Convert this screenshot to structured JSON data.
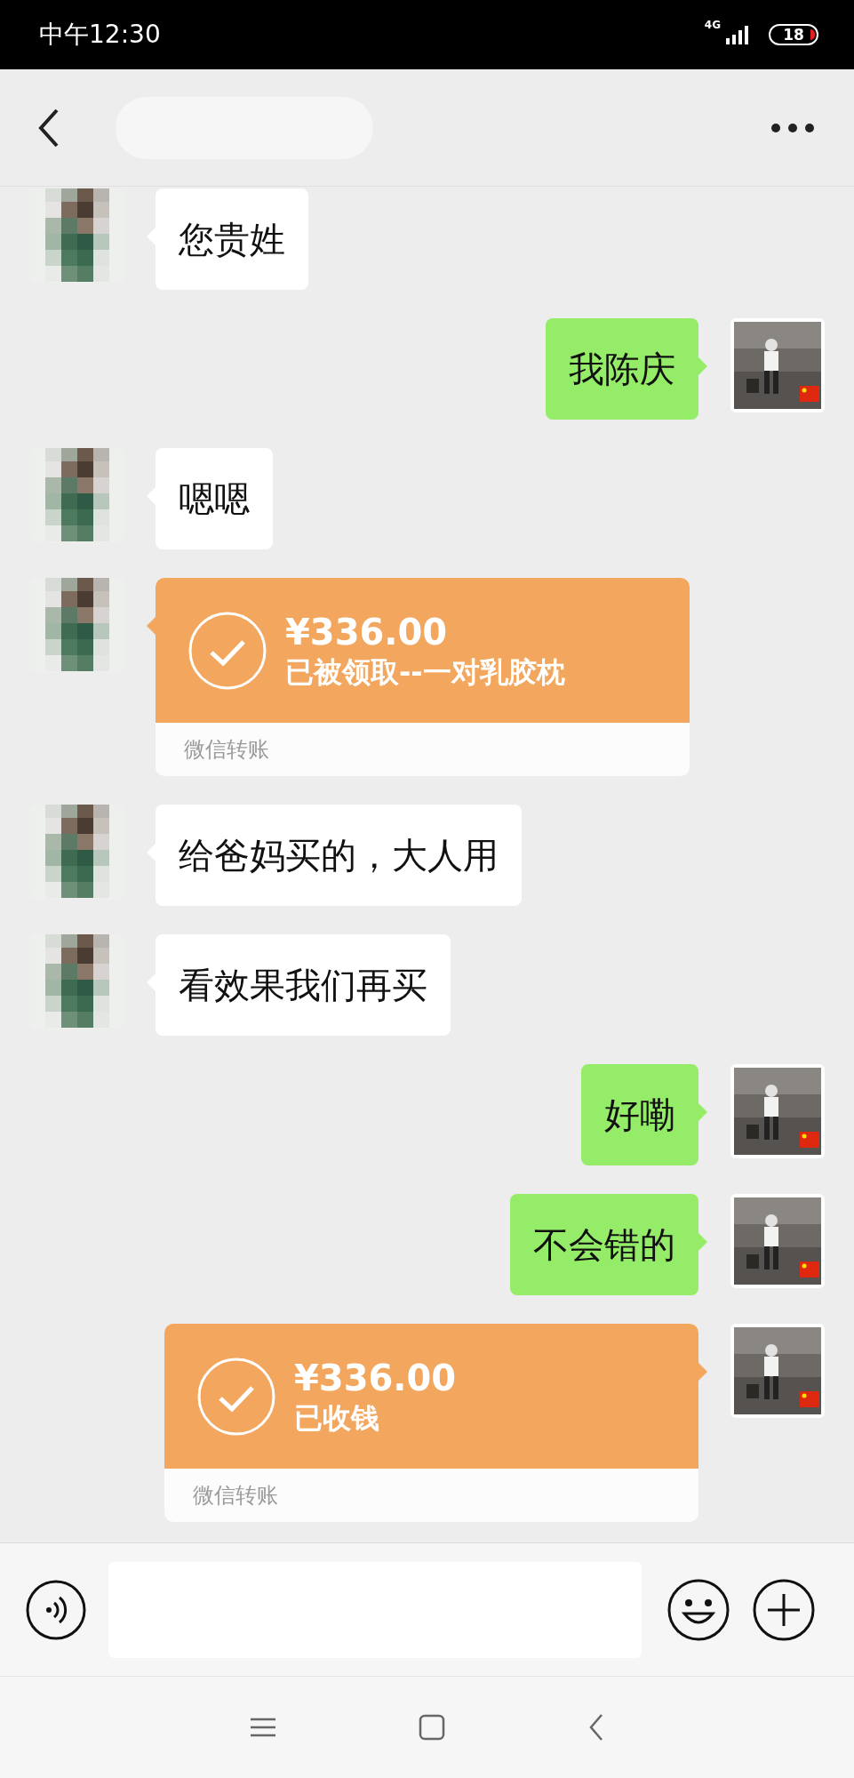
{
  "status_bar": {
    "time": "中午12:30",
    "network": "4G",
    "battery": "18"
  },
  "messages": [
    {
      "outgoing": false,
      "kind": "text",
      "text": "您贵姓"
    },
    {
      "outgoing": true,
      "kind": "text",
      "text": "我陈庆"
    },
    {
      "outgoing": false,
      "kind": "text",
      "text": "嗯嗯"
    },
    {
      "outgoing": false,
      "kind": "transfer",
      "amount": "¥336.00",
      "status": "已被领取--一对乳胶枕",
      "footer": "微信转账"
    },
    {
      "outgoing": false,
      "kind": "text",
      "text": "给爸妈买的，大人用"
    },
    {
      "outgoing": false,
      "kind": "text",
      "text": "看效果我们再买"
    },
    {
      "outgoing": true,
      "kind": "text",
      "text": "好嘞"
    },
    {
      "outgoing": true,
      "kind": "text",
      "text": "不会错的"
    },
    {
      "outgoing": true,
      "kind": "transfer",
      "amount": "¥336.00",
      "status": "已收钱",
      "footer": "微信转账"
    }
  ]
}
